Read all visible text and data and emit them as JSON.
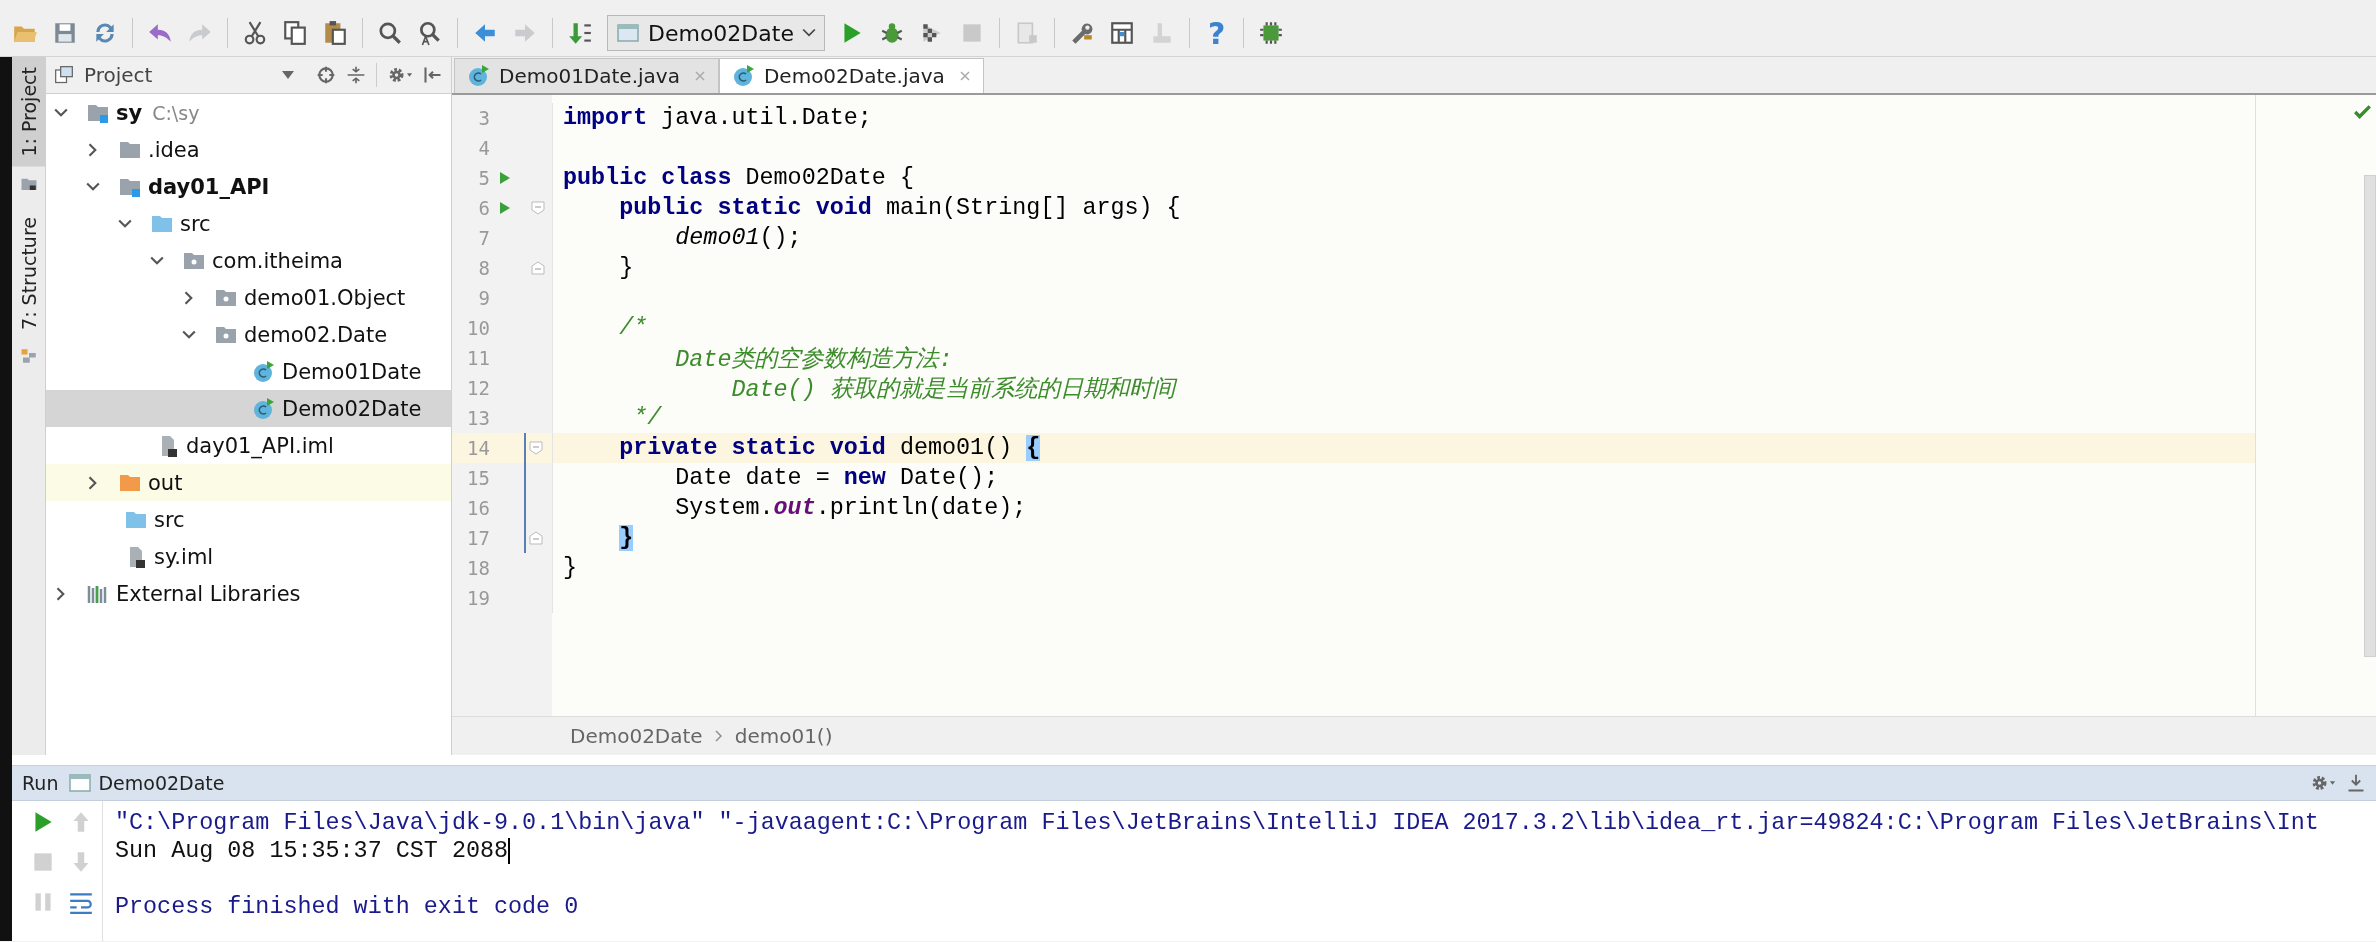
{
  "toolbar": [
    {
      "kind": "open",
      "disabled": false
    },
    {
      "kind": "save",
      "disabled": false
    },
    {
      "kind": "sync",
      "disabled": false
    },
    {
      "kind": "separator"
    },
    {
      "kind": "undo",
      "disabled": false
    },
    {
      "kind": "redo",
      "disabled": true
    },
    {
      "kind": "separator"
    },
    {
      "kind": "cut",
      "disabled": false
    },
    {
      "kind": "copy",
      "disabled": false
    },
    {
      "kind": "paste",
      "disabled": false
    },
    {
      "kind": "separator"
    },
    {
      "kind": "find",
      "disabled": false
    },
    {
      "kind": "replace",
      "disabled": false
    },
    {
      "kind": "separator"
    },
    {
      "kind": "back",
      "disabled": false
    },
    {
      "kind": "forward",
      "disabled": true
    },
    {
      "kind": "separator"
    },
    {
      "kind": "make",
      "disabled": false
    },
    {
      "kind": "config",
      "label": "Demo02Date"
    },
    {
      "kind": "run",
      "disabled": false
    },
    {
      "kind": "debug",
      "disabled": false
    },
    {
      "kind": "coverage",
      "disabled": false
    },
    {
      "kind": "stop",
      "disabled": true
    },
    {
      "kind": "separator"
    },
    {
      "kind": "structure",
      "disabled": true
    },
    {
      "kind": "separator"
    },
    {
      "kind": "wrench",
      "disabled": false
    },
    {
      "kind": "modules",
      "disabled": false
    },
    {
      "kind": "tool",
      "disabled": true
    },
    {
      "kind": "separator"
    },
    {
      "kind": "help",
      "label": "?",
      "disabled": false
    },
    {
      "kind": "separator"
    },
    {
      "kind": "plugin",
      "disabled": false
    }
  ],
  "tool_stripe": [
    {
      "label": "1: Project",
      "selected": true
    },
    {
      "label": "7: Structure",
      "selected": false
    }
  ],
  "project_panel": {
    "title": "Project",
    "tree": [
      {
        "label": "sy",
        "hint": "C:\\sy",
        "kind": "module",
        "expanded": true,
        "selected": false,
        "highlighted": false,
        "children": [
          {
            "label": ".idea",
            "kind": "folder",
            "expanded": false,
            "selected": false,
            "highlighted": false
          },
          {
            "label": "day01_API",
            "kind": "module",
            "expanded": true,
            "selected": false,
            "highlighted": false,
            "children": [
              {
                "label": "src",
                "kind": "source",
                "expanded": true,
                "selected": false,
                "highlighted": false,
                "children": [
                  {
                    "label": "com.itheima",
                    "kind": "package",
                    "expanded": true,
                    "selected": false,
                    "highlighted": false,
                    "children": [
                      {
                        "label": "demo01.Object",
                        "kind": "package",
                        "expanded": false,
                        "selected": false,
                        "highlighted": false
                      },
                      {
                        "label": "demo02.Date",
                        "kind": "package",
                        "expanded": true,
                        "selected": false,
                        "highlighted": false,
                        "children": [
                          {
                            "label": "Demo01Date",
                            "kind": "class",
                            "selected": false,
                            "highlighted": false
                          },
                          {
                            "label": "Demo02Date",
                            "kind": "class",
                            "selected": true,
                            "highlighted": false
                          }
                        ]
                      }
                    ]
                  }
                ]
              },
              {
                "label": "day01_API.iml",
                "kind": "file",
                "selected": false,
                "highlighted": false
              }
            ]
          },
          {
            "label": "out",
            "kind": "excluded",
            "expanded": false,
            "selected": false,
            "highlighted": true
          },
          {
            "label": "src",
            "kind": "source",
            "selected": false,
            "highlighted": false
          },
          {
            "label": "sy.iml",
            "kind": "file",
            "selected": false,
            "highlighted": false
          }
        ]
      },
      {
        "label": "External Libraries",
        "kind": "libraries",
        "expanded": false,
        "selected": false,
        "highlighted": false
      }
    ]
  },
  "editor": {
    "tabs": [
      {
        "label": "Demo01Date.java",
        "selected": false
      },
      {
        "label": "Demo02Date.java",
        "selected": true
      }
    ],
    "lines": [
      {
        "number": "3",
        "runnable": false,
        "fold_open": false,
        "fold_close": false,
        "current": false,
        "changed": false,
        "tokens": [
          {
            "text": "import",
            "kind": "keyword"
          },
          {
            "text": " java.util.Date;",
            "kind": "plain"
          }
        ]
      },
      {
        "number": "4",
        "runnable": false,
        "fold_open": false,
        "fold_close": false,
        "current": false,
        "changed": false
      },
      {
        "number": "5",
        "runnable": true,
        "fold_open": false,
        "fold_close": false,
        "current": false,
        "changed": false,
        "tokens": [
          {
            "text": "public class",
            "kind": "keyword"
          },
          {
            "text": " Demo02Date {",
            "kind": "plain"
          }
        ]
      },
      {
        "number": "6",
        "runnable": true,
        "fold_open": true,
        "fold_close": false,
        "current": false,
        "changed": false,
        "tokens": [
          {
            "text": "    public static void",
            "kind": "keyword"
          },
          {
            "text": " main(String[] args) {",
            "kind": "plain"
          }
        ]
      },
      {
        "number": "7",
        "runnable": false,
        "fold_open": false,
        "fold_close": false,
        "current": false,
        "changed": false,
        "tokens": [
          {
            "text": "        demo01",
            "kind": "call"
          },
          {
            "text": "();",
            "kind": "plain"
          }
        ]
      },
      {
        "number": "8",
        "runnable": false,
        "fold_open": false,
        "fold_close": true,
        "current": false,
        "changed": false,
        "tokens": [
          {
            "text": "    }",
            "kind": "plain"
          }
        ]
      },
      {
        "number": "9",
        "runnable": false,
        "fold_open": false,
        "fold_close": false,
        "current": false,
        "changed": false
      },
      {
        "number": "10",
        "runnable": false,
        "fold_open": false,
        "fold_close": false,
        "current": false,
        "changed": false,
        "tokens": [
          {
            "text": "    /*",
            "kind": "comment"
          }
        ]
      },
      {
        "number": "11",
        "runnable": false,
        "fold_open": false,
        "fold_close": false,
        "current": false,
        "changed": false,
        "tokens": [
          {
            "text": "        Date类的空参数构造方法:",
            "kind": "comment"
          }
        ]
      },
      {
        "number": "12",
        "runnable": false,
        "fold_open": false,
        "fold_close": false,
        "current": false,
        "changed": false,
        "tokens": [
          {
            "text": "            Date() 获取的就是当前系统的日期和时间",
            "kind": "comment"
          }
        ]
      },
      {
        "number": "13",
        "runnable": false,
        "fold_open": false,
        "fold_close": false,
        "current": false,
        "changed": false,
        "tokens": [
          {
            "text": "     */",
            "kind": "comment"
          }
        ]
      },
      {
        "number": "14",
        "runnable": false,
        "fold_open": true,
        "fold_close": false,
        "current": true,
        "changed": true,
        "tokens": [
          {
            "text": "    private static void",
            "kind": "keyword"
          },
          {
            "text": " demo01() ",
            "kind": "plain"
          },
          {
            "text": "{",
            "kind": "match"
          }
        ]
      },
      {
        "number": "15",
        "runnable": false,
        "fold_open": false,
        "fold_close": false,
        "current": false,
        "changed": true,
        "tokens": [
          {
            "text": "        Date date = ",
            "kind": "plain"
          },
          {
            "text": "new",
            "kind": "keyword"
          },
          {
            "text": " Date();",
            "kind": "plain"
          }
        ]
      },
      {
        "number": "16",
        "runnable": false,
        "fold_open": false,
        "fold_close": false,
        "current": false,
        "changed": true,
        "tokens": [
          {
            "text": "        System.",
            "kind": "plain"
          },
          {
            "text": "out",
            "kind": "static"
          },
          {
            "text": ".println(date);",
            "kind": "plain"
          }
        ]
      },
      {
        "number": "17",
        "runnable": false,
        "fold_open": false,
        "fold_close": true,
        "current": false,
        "changed": true,
        "tokens": [
          {
            "text": "    }",
            "kind": "match"
          }
        ]
      },
      {
        "number": "18",
        "runnable": false,
        "fold_open": false,
        "fold_close": false,
        "current": false,
        "changed": false,
        "tokens": [
          {
            "text": "}",
            "kind": "plain"
          }
        ]
      },
      {
        "number": "19",
        "runnable": false,
        "fold_open": false,
        "fold_close": false,
        "current": false,
        "changed": false
      }
    ],
    "breadcrumbs": [
      "Demo02Date",
      "demo01()"
    ]
  },
  "run_panel": {
    "title": "Run",
    "tab": "Demo02Date",
    "buttons": [
      {
        "kind": "rerun",
        "disabled": false
      },
      {
        "kind": "up",
        "disabled": true
      },
      {
        "kind": "stop",
        "disabled": true
      },
      {
        "kind": "down",
        "disabled": true
      },
      {
        "kind": "pause",
        "disabled": true
      },
      {
        "kind": "wrap",
        "disabled": false
      }
    ],
    "console": [
      {
        "kind": "command",
        "text": "\"C:\\Program Files\\Java\\jdk-9.0.1\\bin\\java\" \"-javaagent:C:\\Program Files\\JetBrains\\IntelliJ IDEA 2017.3.2\\lib\\idea_rt.jar=49824:C:\\Program Files\\JetBrains\\Int",
        "caret": false
      },
      {
        "kind": "output",
        "text": "Sun Aug 08 15:35:37 CST 2088",
        "caret": true
      },
      {
        "kind": "blank",
        "caret": false
      },
      {
        "kind": "status",
        "text": "Process finished with exit code 0",
        "caret": false
      }
    ]
  }
}
